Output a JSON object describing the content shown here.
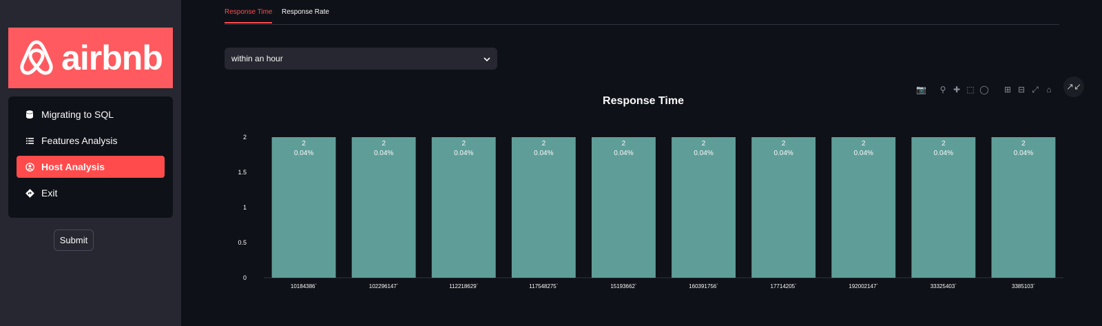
{
  "sidebar": {
    "logo_text": "airbnb",
    "menu": [
      {
        "label": "Migrating to SQL",
        "icon": "database-icon",
        "active": false
      },
      {
        "label": "Features Analysis",
        "icon": "list-icon",
        "active": false
      },
      {
        "label": "Host Analysis",
        "icon": "person-circle-icon",
        "active": true
      },
      {
        "label": "Exit",
        "icon": "sign-turn-icon",
        "active": false
      }
    ],
    "submit_label": "Submit"
  },
  "tabs": [
    {
      "label": "Response Time",
      "active": true
    },
    {
      "label": "Response Rate",
      "active": false
    }
  ],
  "select": {
    "value": "within an hour"
  },
  "toolbar_icons": [
    "camera-icon",
    "zoom-icon",
    "pan-icon",
    "box-select-icon",
    "lasso-select-icon",
    "zoom-in-icon",
    "zoom-out-icon",
    "autoscale-icon",
    "reset-axes-icon",
    "plotly-logo-icon"
  ],
  "colors": {
    "accent": "#ff4b4b",
    "brand": "#ff5a5f",
    "bar": "#5f9e98"
  },
  "chart_data": {
    "type": "bar",
    "title": "Response Time",
    "categories": [
      "10184386`",
      "102296147`",
      "112218629`",
      "117548275`",
      "15193662`",
      "160391756`",
      "17714205`",
      "192002147`",
      "33325403`",
      "3385103`"
    ],
    "values": [
      2,
      2,
      2,
      2,
      2,
      2,
      2,
      2,
      2,
      2
    ],
    "labels": [
      "0.04%",
      "0.04%",
      "0.04%",
      "0.04%",
      "0.04%",
      "0.04%",
      "0.04%",
      "0.04%",
      "0.04%",
      "0.04%"
    ],
    "yticks": [
      "0",
      "0.5",
      "1",
      "1.5",
      "2"
    ],
    "ylim": [
      0,
      2
    ]
  }
}
